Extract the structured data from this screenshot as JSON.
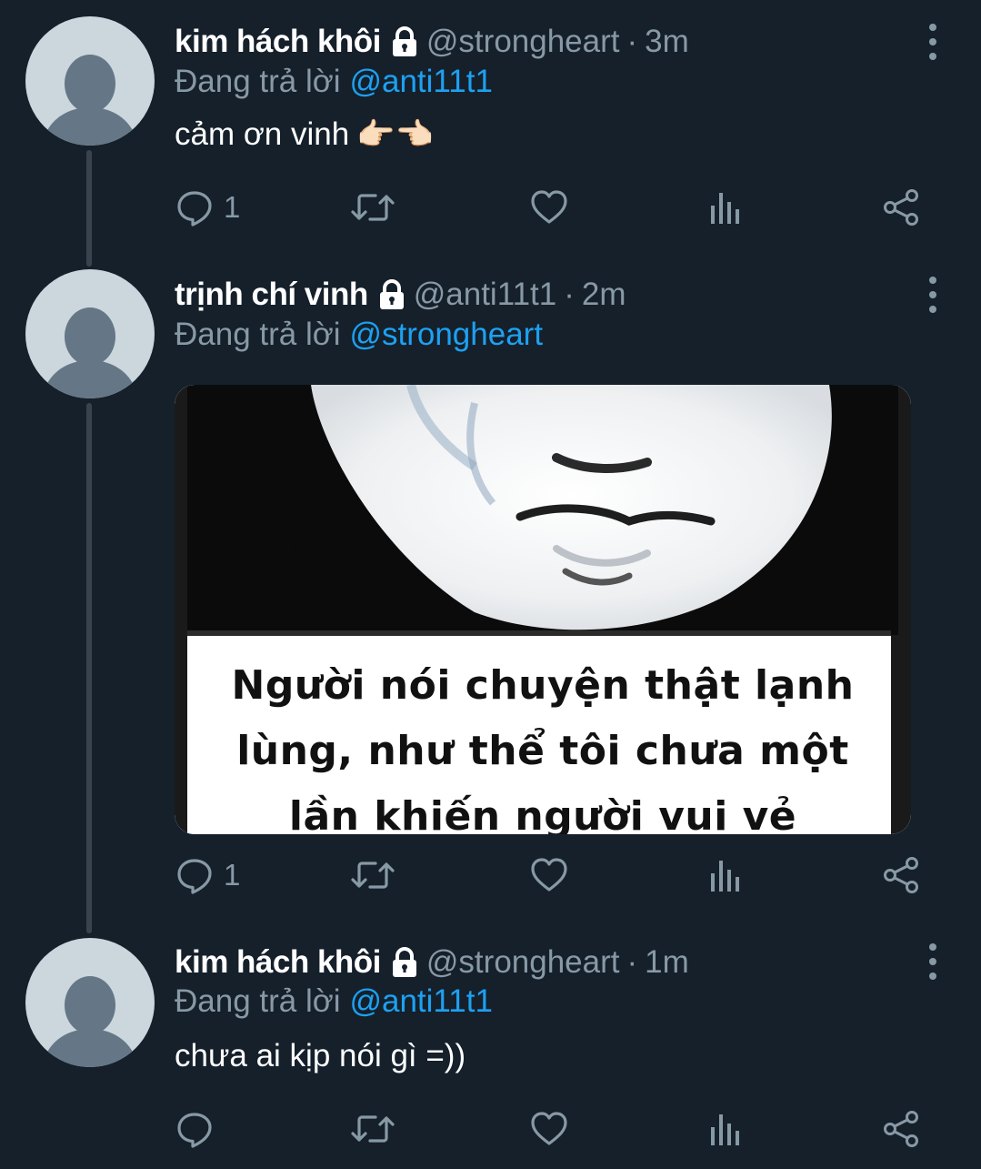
{
  "thread": [
    {
      "name": "kim hách khôi",
      "handle": "@strongheart",
      "time": "3m",
      "reply_prefix": "Đang trả lời",
      "reply_to": "@anti11t1",
      "text": "cảm ơn vinh",
      "emoji": "👉🏻👈🏻",
      "reply_count": "1"
    },
    {
      "name": "trịnh chí vinh",
      "handle": "@anti11t1",
      "time": "2m",
      "reply_prefix": "Đang trả lời",
      "reply_to": "@strongheart",
      "media_caption": [
        "Người nói chuyện thật lạnh",
        "lùng, như thể tôi chưa một",
        "lần khiến người vui vẻ"
      ],
      "reply_count": "1"
    },
    {
      "name": "kim hách khôi",
      "handle": "@strongheart",
      "time": "1m",
      "reply_prefix": "Đang trả lời",
      "reply_to": "@anti11t1",
      "text": "chưa ai kịp nói gì =))",
      "reply_count": ""
    }
  ],
  "separator": "·",
  "icons": {
    "lock": "lock-icon",
    "more": "more-vertical-icon",
    "reply": "reply-icon",
    "retweet": "retweet-icon",
    "like": "heart-icon",
    "analytics": "analytics-icon",
    "share": "share-icon"
  },
  "colors": {
    "background": "#15202b",
    "secondary_text": "#8899a6",
    "link": "#1da1f2",
    "thread_line": "#38444d",
    "avatar_bg": "#ccd6dd",
    "avatar_fg": "#657786"
  }
}
